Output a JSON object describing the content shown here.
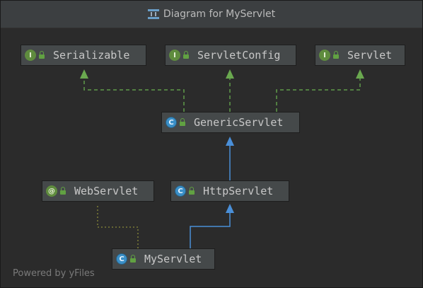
{
  "window": {
    "title": "Diagram for MyServlet",
    "icon": "diagram-icon"
  },
  "nodes": {
    "serializable": {
      "kind": "I",
      "label": "Serializable"
    },
    "servletconfig": {
      "kind": "I",
      "label": "ServletConfig"
    },
    "servlet": {
      "kind": "I",
      "label": "Servlet"
    },
    "genericservlet": {
      "kind": "C",
      "label": "GenericServlet"
    },
    "webservlet": {
      "kind": "@",
      "label": "WebServlet"
    },
    "httpservlet": {
      "kind": "C",
      "label": "HttpServlet"
    },
    "myservlet": {
      "kind": "C",
      "label": "MyServlet"
    }
  },
  "footer": {
    "powered_by": "Powered by yFiles"
  },
  "colors": {
    "implements_edge": "#5f9b4a",
    "extends_edge": "#4a8fd8",
    "annotation_edge": "#8a8a3a"
  }
}
